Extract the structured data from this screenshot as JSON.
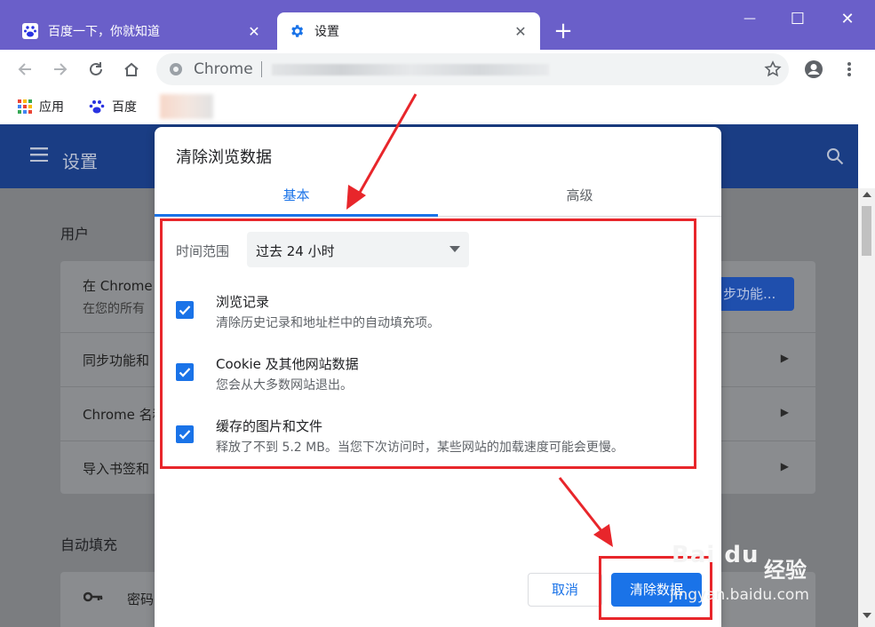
{
  "tabs": [
    {
      "label": "百度一下，你就知道",
      "close": "✕"
    },
    {
      "label": "设置",
      "close": "✕"
    }
  ],
  "new_tab": "+",
  "window_controls": {
    "minimize": "—",
    "maximize": "☐",
    "close": "✕"
  },
  "omnibox": {
    "prefix": "Chrome"
  },
  "bookmarks": [
    {
      "label": "应用",
      "icon": "apps-grid-icon"
    },
    {
      "label": "百度",
      "icon": "baidu-paw-icon"
    }
  ],
  "settings": {
    "title": "设置",
    "section_people": "用户",
    "sync_row_title": "在 Chrome",
    "sync_row_sub": "在您的所有",
    "sync_button": "步功能...",
    "rows": [
      "同步功能和",
      "Chrome 名称",
      "导入书签和"
    ],
    "section_autofill": "自动填充",
    "passwords_row": "密码"
  },
  "dialog": {
    "title": "清除浏览数据",
    "tabs": {
      "basic": "基本",
      "advanced": "高级"
    },
    "time_range": {
      "label": "时间范围",
      "value": "过去 24 小时"
    },
    "options": [
      {
        "title": "浏览记录",
        "desc": "清除历史记录和地址栏中的自动填充项。",
        "checked": true
      },
      {
        "title": "Cookie 及其他网站数据",
        "desc": "您会从大多数网站退出。",
        "checked": true
      },
      {
        "title": "缓存的图片和文件",
        "desc": "释放了不到 5.2 MB。当您下次访问时，某些网站的加载速度可能会更慢。",
        "checked": true
      }
    ],
    "cancel": "取消",
    "clear": "清除数据"
  },
  "watermark": {
    "logo": "Bai du",
    "text": "经验",
    "url": "jingyan.baidu.com"
  },
  "colors": {
    "accent": "#1a73e8",
    "titlebar": "#6a5fc9",
    "annotation": "#e8262b",
    "header": "#1a3d84"
  }
}
